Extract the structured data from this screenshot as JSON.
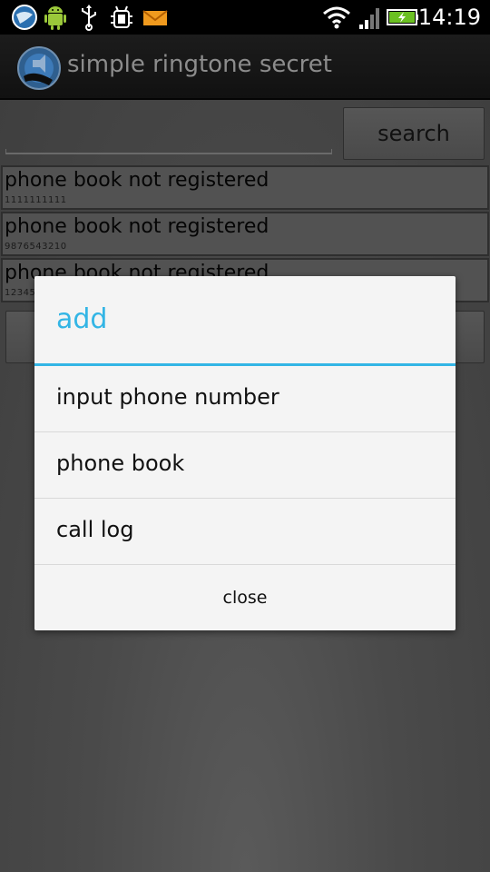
{
  "status_bar": {
    "time": "14:19",
    "icons": [
      "globe-icon",
      "android-icon",
      "usb-icon",
      "debug-icon",
      "mail-icon",
      "wifi-icon",
      "signal-icon",
      "battery-charging-icon"
    ]
  },
  "action_bar": {
    "title": "simple ringtone secret",
    "icon": "app-icon"
  },
  "search": {
    "input_value": "",
    "button_label": "search"
  },
  "list": {
    "items": [
      {
        "title": "phone book not registered",
        "number": "1111111111"
      },
      {
        "title": "phone book not registered",
        "number": "9876543210"
      },
      {
        "title": "phone book not registered",
        "number": "12345"
      }
    ]
  },
  "dialog": {
    "title": "add",
    "items": [
      {
        "label": "input phone number"
      },
      {
        "label": "phone book"
      },
      {
        "label": "call log"
      }
    ],
    "close_label": "close"
  },
  "colors": {
    "accent": "#33b5e5",
    "dialog_bg": "#f4f4f4",
    "background": "#4a4a4a"
  }
}
